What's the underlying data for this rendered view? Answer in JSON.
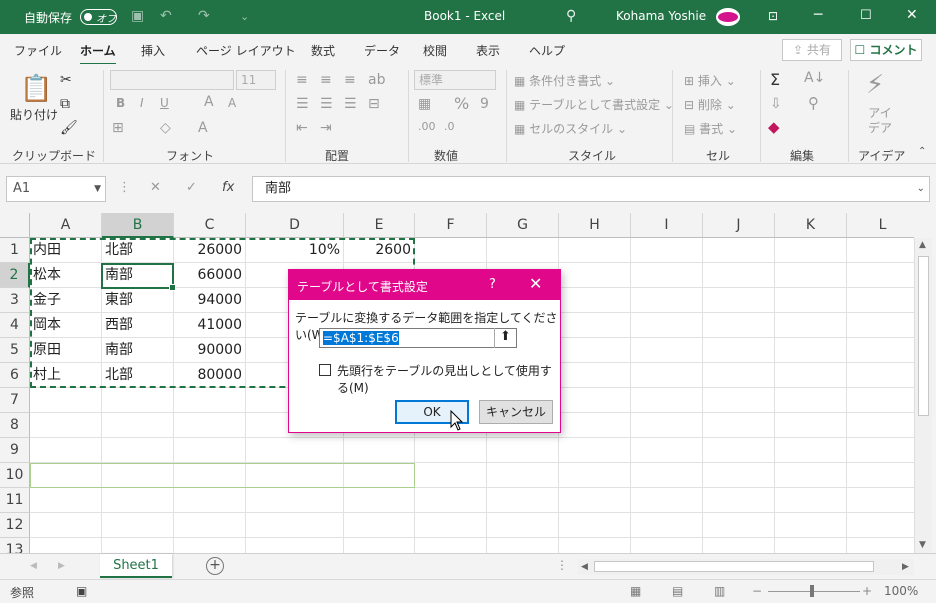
{
  "titlebar": {
    "autosave_label": "自動保存",
    "autosave_state": "オフ",
    "document_title": "Book1  -  Excel",
    "user_name": "Kohama Yoshie"
  },
  "tabs": [
    "ファイル",
    "ホーム",
    "挿入",
    "ページ レイアウト",
    "数式",
    "データ",
    "校閲",
    "表示",
    "ヘルプ"
  ],
  "active_tab": "ホーム",
  "share_label": "共有",
  "comment_label": "コメント",
  "ribbon": {
    "clipboard": {
      "label": "クリップボード",
      "paste": "貼り付け"
    },
    "font": {
      "label": "フォント",
      "font_size": "11",
      "bold": "B",
      "italic": "I",
      "underline": "U"
    },
    "alignment": {
      "label": "配置"
    },
    "number": {
      "label": "数値",
      "format": "標準"
    },
    "styles": {
      "label": "スタイル",
      "conditional": "条件付き書式",
      "as_table": "テーブルとして書式設定",
      "cell_styles": "セルのスタイル"
    },
    "cells": {
      "label": "セル",
      "insert": "挿入",
      "delete": "削除",
      "format": "書式"
    },
    "editing": {
      "label": "編集"
    },
    "ideas": {
      "label": "アイデア",
      "button": "アイ\nデア"
    }
  },
  "formula_bar": {
    "name_box": "A1",
    "formula": "南部"
  },
  "columns": [
    "A",
    "B",
    "C",
    "D",
    "E",
    "F",
    "G",
    "H",
    "I",
    "J",
    "K",
    "L"
  ],
  "selected_column": "B",
  "rows": [
    "1",
    "2",
    "3",
    "4",
    "5",
    "6",
    "7",
    "8",
    "9",
    "10",
    "11",
    "12",
    "13"
  ],
  "selected_row": "2",
  "cells": [
    [
      "内田",
      "北部",
      "26000",
      "10%",
      "2600"
    ],
    [
      "松本",
      "南部",
      "66000",
      "",
      ""
    ],
    [
      "金子",
      "東部",
      "94000",
      "",
      ""
    ],
    [
      "岡本",
      "西部",
      "41000",
      "",
      ""
    ],
    [
      "原田",
      "南部",
      "90000",
      "",
      ""
    ],
    [
      "村上",
      "北部",
      "80000",
      "",
      ""
    ]
  ],
  "sheet_tab": "Sheet1",
  "status": {
    "mode": "参照",
    "zoom": "100%"
  },
  "dialog": {
    "title": "テーブルとして書式設定",
    "help": "?",
    "close": "✕",
    "prompt": "テーブルに変換するデータ範囲を指定してください(W)",
    "range": "=$A$1:$E$6",
    "checkbox_label": "先頭行をテーブルの見出しとして使用する(M)",
    "checkbox_checked": false,
    "ok": "OK",
    "cancel": "キャンセル"
  },
  "colors": {
    "excel_green": "#217346",
    "dialog_accent": "#e0078a"
  }
}
